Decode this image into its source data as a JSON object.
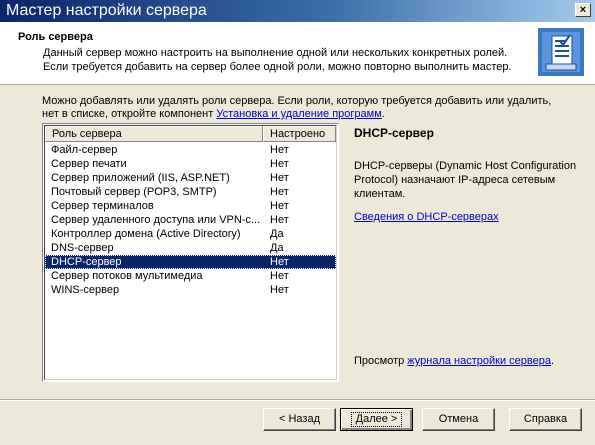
{
  "window": {
    "title": "Мастер настройки сервера",
    "close_glyph": "×"
  },
  "header": {
    "title": "Роль сервера",
    "subtitle": "Данный сервер можно настроить на выполнение одной или нескольких конкретных ролей. Если требуется добавить на сервер более одной роли, можно повторно выполнить мастер.",
    "icon": "server-wizard-icon"
  },
  "intro": {
    "text_before": "Можно добавлять или удалять роли сервера. Если роли, которую требуется добавить или удалить, нет в списке, откройте компонент ",
    "link": "Установка и удаление программ",
    "text_after": "."
  },
  "roles_table": {
    "columns": [
      "Роль сервера",
      "Настроено"
    ],
    "rows": [
      {
        "role": "Файл-сервер",
        "configured": "Нет"
      },
      {
        "role": "Сервер печати",
        "configured": "Нет"
      },
      {
        "role": "Сервер приложений (IIS, ASP.NET)",
        "configured": "Нет"
      },
      {
        "role": "Почтовый сервер (POP3, SMTP)",
        "configured": "Нет"
      },
      {
        "role": "Сервер терминалов",
        "configured": "Нет"
      },
      {
        "role": "Сервер удаленного доступа или VPN-с...",
        "configured": "Нет"
      },
      {
        "role": "Контроллер домена (Active Directory)",
        "configured": "Да"
      },
      {
        "role": "DNS-сервер",
        "configured": "Да"
      },
      {
        "role": "DHCP-сервер",
        "configured": "Нет"
      },
      {
        "role": "Сервер потоков мультимедиа",
        "configured": "Нет"
      },
      {
        "role": "WINS-сервер",
        "configured": "Нет"
      }
    ],
    "selected_index": 8
  },
  "detail": {
    "title": "DHCP-сервер",
    "description": "DHCP-серверы (Dynamic Host Configuration Protocol) назначают IP-адреса сетевым клиентам.",
    "link": "Сведения о DHCP-серверах"
  },
  "log": {
    "text_before": "Просмотр ",
    "link": "журнала настройки сервера",
    "text_after": "."
  },
  "buttons": {
    "back": "< Назад",
    "next": "Далее >",
    "cancel": "Отмена",
    "help": "Справка"
  },
  "colors": {
    "selection": "#0a246a",
    "link": "#0000cc",
    "face": "#ece9d8"
  }
}
